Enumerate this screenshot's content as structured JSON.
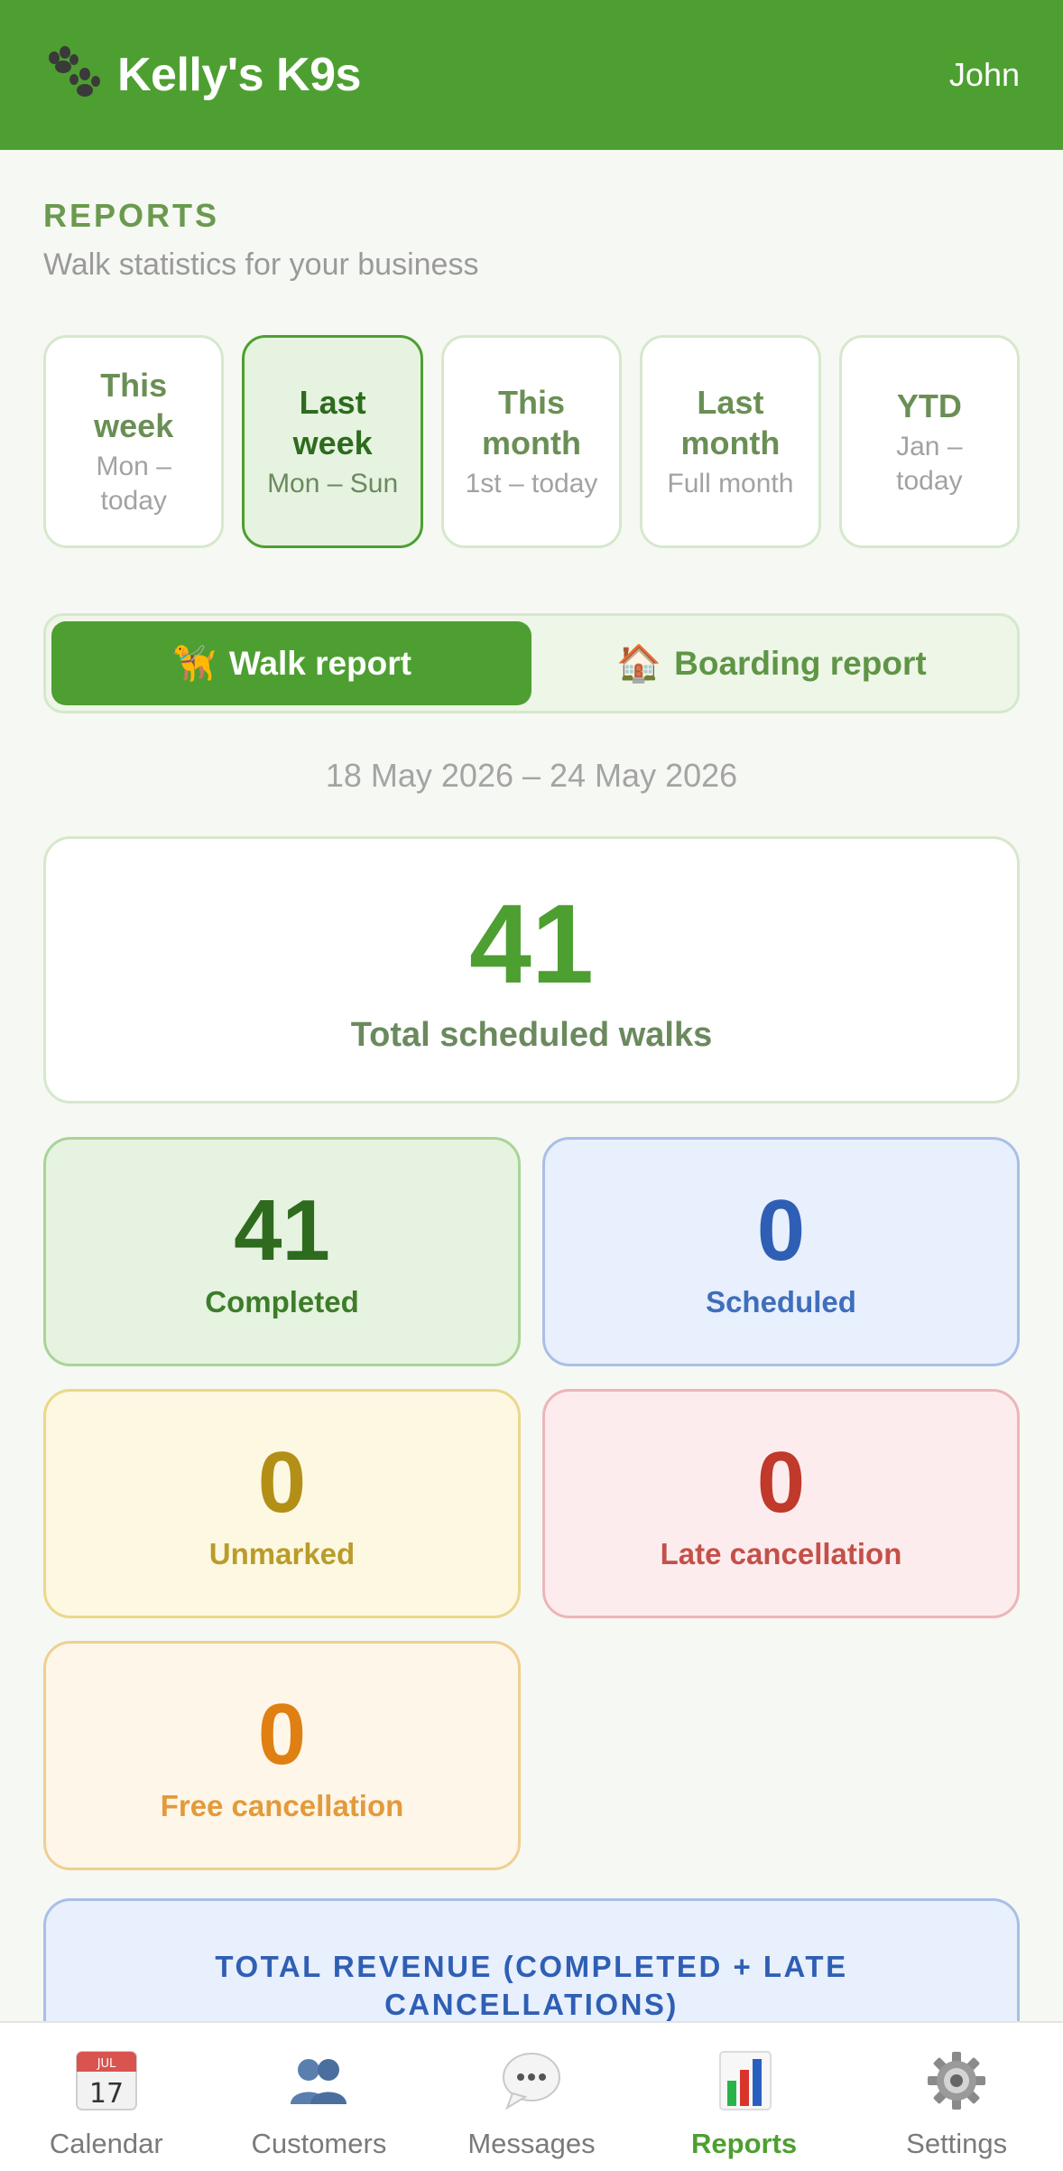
{
  "header": {
    "brand": "Kelly's K9s",
    "user": "John",
    "logo_icon": "paw-icon",
    "accent_color": "#4e9f31"
  },
  "reports": {
    "title": "REPORTS",
    "subtitle": "Walk statistics for your business"
  },
  "periods": [
    {
      "title_line1": "This",
      "title_line2": "week",
      "range_line1": "Mon –",
      "range_line2": "today",
      "active": false
    },
    {
      "title_line1": "Last",
      "title_line2": "week",
      "range_line1": "Mon – Sun",
      "range_line2": "",
      "active": true
    },
    {
      "title_line1": "This",
      "title_line2": "month",
      "range_line1": "1st – today",
      "range_line2": "",
      "active": false
    },
    {
      "title_line1": "Last",
      "title_line2": "month",
      "range_line1": "Full month",
      "range_line2": "",
      "active": false
    },
    {
      "title_line1": "YTD",
      "title_line2": "",
      "range_line1": "Jan –",
      "range_line2": "today",
      "active": false
    }
  ],
  "report_toggle": {
    "walk": {
      "label": "Walk report",
      "icon": "🦮",
      "active": true
    },
    "boarding": {
      "label": "Boarding report",
      "icon": "🏠",
      "active": false
    }
  },
  "date_range": "18 May 2026 – 24 May 2026",
  "total": {
    "value": "41",
    "label": "Total scheduled walks"
  },
  "stats": {
    "completed": {
      "value": "41",
      "label": "Completed",
      "color": "#2e6b1e"
    },
    "scheduled": {
      "value": "0",
      "label": "Scheduled",
      "color": "#2f5fb4"
    },
    "unmarked": {
      "value": "0",
      "label": "Unmarked",
      "color": "#b38f16"
    },
    "late_cancellation": {
      "value": "0",
      "label": "Late cancellation",
      "color": "#c0392b"
    },
    "free_cancellation": {
      "value": "0",
      "label": "Free cancellation",
      "color": "#e07f12"
    }
  },
  "revenue": {
    "title": "TOTAL REVENUE (COMPLETED + LATE CANCELLATIONS)"
  },
  "bottom_nav": [
    {
      "label": "Calendar",
      "icon": "calendar-icon",
      "calendar_month": "JUL",
      "calendar_day": "17",
      "active": false
    },
    {
      "label": "Customers",
      "icon": "customers-icon",
      "active": false
    },
    {
      "label": "Messages",
      "icon": "messages-icon",
      "active": false
    },
    {
      "label": "Reports",
      "icon": "reports-icon",
      "active": true
    },
    {
      "label": "Settings",
      "icon": "gear-icon",
      "active": false
    }
  ]
}
